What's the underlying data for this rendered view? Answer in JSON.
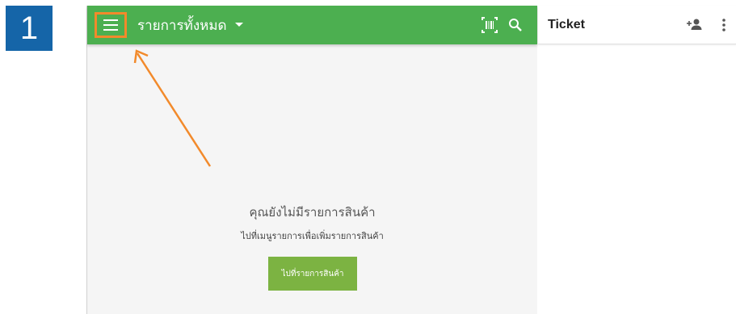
{
  "step_number": "1",
  "toolbar": {
    "title": "รายการทั้งหมด",
    "dropdown_icon": "arrow-drop-down-icon",
    "menu_icon": "hamburger-menu-icon",
    "scan_icon": "barcode-scan-icon",
    "search_icon": "search-icon",
    "background_color": "#4caf50"
  },
  "empty_state": {
    "title": "คุณยังไม่มีรายการสินค้า",
    "subtitle": "ไปที่เมนูรายการเพื่อเพิ่มรายการสินค้า",
    "button_label": "ไปที่รายการสินค้า",
    "button_color": "#7cb342"
  },
  "ticket": {
    "title": "Ticket",
    "add_customer_icon": "add-person-icon",
    "more_icon": "more-vert-icon"
  },
  "annotation": {
    "highlight_color": "#f28a2b",
    "badge_color": "#1565a8"
  }
}
